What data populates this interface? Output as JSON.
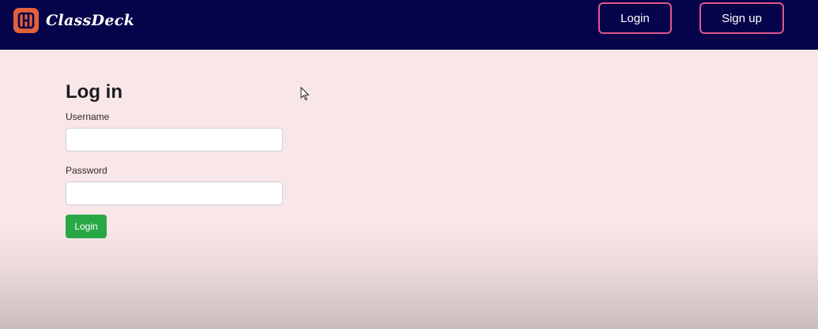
{
  "header": {
    "brand_name": "ClassDeck",
    "logo_icon": "classdeck-logo-icon",
    "login_label": "Login",
    "signup_label": "Sign up"
  },
  "form": {
    "title": "Log in",
    "username_label": "Username",
    "username_value": "",
    "username_placeholder": "",
    "password_label": "Password",
    "password_value": "",
    "password_placeholder": "",
    "submit_label": "Login"
  },
  "colors": {
    "navbar_bg": "#05034a",
    "nav_button_border": "#e0578a",
    "logo_accent": "#e2613a",
    "page_bg": "#f7e6e8",
    "submit_bg": "#28a745"
  }
}
